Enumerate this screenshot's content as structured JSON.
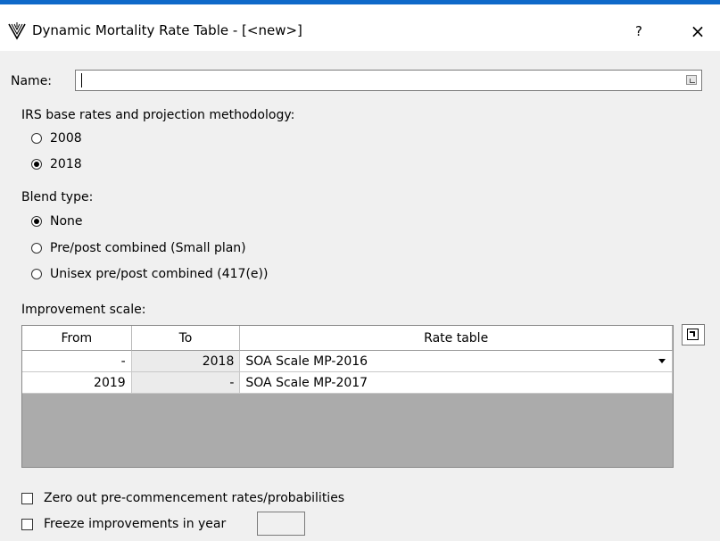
{
  "window": {
    "title": "Dynamic Mortality Rate Table - [<new>]",
    "help_label": "?",
    "close_label": "×"
  },
  "name_field": {
    "label": "Name:",
    "value": ""
  },
  "irs_section": {
    "label": "IRS base rates and projection methodology:",
    "options": [
      {
        "label": "2008",
        "selected": false
      },
      {
        "label": "2018",
        "selected": true
      }
    ]
  },
  "blend_section": {
    "label": "Blend type:",
    "options": [
      {
        "label": "None",
        "selected": true
      },
      {
        "label": "Pre/post combined (Small plan)",
        "selected": false
      },
      {
        "label": "Unisex pre/post combined (417(e))",
        "selected": false
      }
    ]
  },
  "improvement_scale": {
    "label": "Improvement scale:",
    "columns": [
      "From",
      "To",
      "Rate table"
    ],
    "rows": [
      {
        "from": "-",
        "to": "2018",
        "rate_table": "SOA Scale MP-2016"
      },
      {
        "from": "2019",
        "to": "-",
        "rate_table": "SOA Scale MP-2017"
      }
    ]
  },
  "options": {
    "zero_out_label": "Zero out pre-commencement rates/probabilities",
    "zero_out_checked": false,
    "freeze_label": "Freeze improvements in year",
    "freeze_checked": false,
    "freeze_year": ""
  },
  "colors": {
    "accent": "#0f69c9",
    "dialog_bg": "#f0f0f0"
  }
}
